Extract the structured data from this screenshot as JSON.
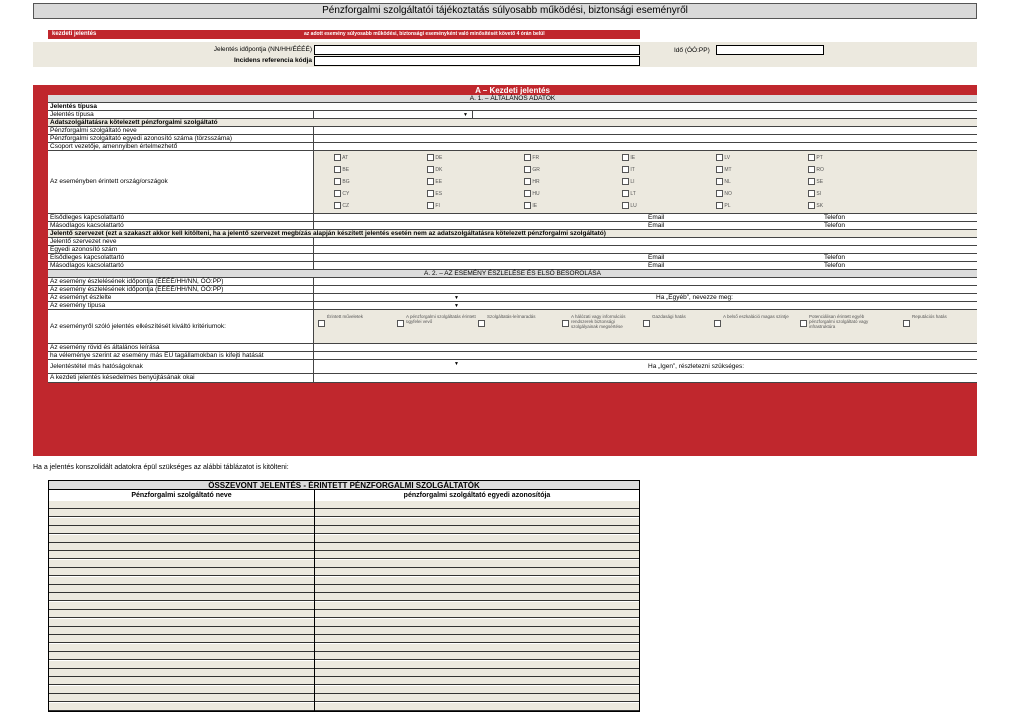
{
  "title": "Pénzforgalmi szolgáltatói tájékoztatás súlyosabb működési, biztonsági eseményről",
  "header": {
    "report_type": "kezdeti jelentés",
    "deadline_note": "az adott esemény súlyosabb működési, biztonsági eseményként való minősítését követő 4 órán belül",
    "date_label": "Jelentés időpontja (NN/HH/ÉÉÉÉ)",
    "ref_label": "Incidens referencia kódja",
    "time_label": "Idő (ÓÓ:PP)"
  },
  "section_a": {
    "title": "A – Kezdeti jelentés",
    "sub1": "A. 1. – ÁLTALÁNOS ADATOK",
    "report_type_head": "Jelentés típusa",
    "report_type_row": "Jelentés típusa",
    "obligated_head": "Adatszolgáltatásra kötelezett pénzforgalmi szolgáltató",
    "provider_name": "Pénzforgalmi szolgáltató neve",
    "provider_id": "Pénzforgalmi szolgáltató egyedi azonosító száma (törzsszáma)",
    "group_leader": "Csoport vezetője, amennyiben értelmezhető",
    "countries_label": "Az eseményben érintett ország/országok",
    "countries": [
      [
        "AT",
        "DE",
        "FR",
        "IE",
        "LV",
        "PT"
      ],
      [
        "BE",
        "DK",
        "GR",
        "IT",
        "MT",
        "RO"
      ],
      [
        "BG",
        "EE",
        "HR",
        "LI",
        "NL",
        "SE"
      ],
      [
        "CY",
        "ES",
        "HU",
        "LT",
        "NO",
        "SI"
      ],
      [
        "CZ",
        "FI",
        "IE",
        "LU",
        "PL",
        "SK"
      ]
    ],
    "primary_contact": "Elsődleges kapcsolattartó",
    "secondary_contact": "Másodlagos kacsolattartó",
    "email": "Email",
    "phone": "Telefon",
    "reporting_entity_head": "Jelentő szervezet (ezt a szakaszt akkor kell kitölteni, ha a jelentő szervezet megbízás alapján készített jelentés esetén nem az adatszolgáltatásra kötelezett pénzforgalmi szolgáltató)",
    "reporting_entity_name": "Jelentő szervezet neve",
    "unique_id": "Egyedi azonosító szám",
    "primary_contact2": "Elsődleges kapcsolattartó",
    "secondary_contact2": "Másodlagos kacsolattartó",
    "sub2": "A. 2. – AZ ESEMÉNY ÉSZLELÉSE ÉS ELSŐ BESOROLÁSA",
    "detect_time1": "Az esemény észlelésének időpontja (ÉÉÉÉ/HH/NN, ÓÓ:PP)",
    "detect_time2": "Az esemény észlelésének időpontja (ÉÉÉÉ/HH/NN, ÓÓ:PP)",
    "detected_by": "Az eseményt észlelte",
    "other_label": "Ha „Egyéb”, nevezze meg:",
    "event_type": "Az esemény típusa",
    "criteria_label": "Az eseményről szóló jelentés elkészítését kiváltó kritériumok:",
    "criteria": [
      "Érintett műveletek",
      "A pénzforgalmi szolgáltatás érintett ügyfelei vevő",
      "Szolgáltatás-leírnaradás",
      "A hálózati vagy információs rendszerek biztonsági szolgályainak megsértése",
      "Gazdasági hatás",
      "A belső eszkaláció magas szintje",
      "Potenciálisan érintett egyéb pénzforgalmi szolgáltató vagy infrastruktúra",
      "Reputációs hatás"
    ],
    "short_desc": "Az esemény rövid és általános leírása",
    "other_states": "ha véleménye szerint az esemény más EU tagállamokban is kifejti hatását",
    "other_authorities": "Jelentéstétel más hatóságoknak",
    "yes_detail": "Ha „Igen”, részletezni szükséges:",
    "delay_reasons": "A kezdeti jelentés késedelmes benyújtásának okai"
  },
  "consolidated_note": "Ha a jelentés konszolidált adatokra épül szükséges az alábbi táblázatot is kitölteni:",
  "consolidated_table": {
    "title": "ÖSSZEVONT JELENTÉS - ÉRINTETT PÉNZFORGALMI SZOLGÁLTATÓK",
    "col1": "Pénzforgalmi szolgáltató neve",
    "col2": "pénzforgalmi szolgáltató egyedi azonosítója"
  }
}
